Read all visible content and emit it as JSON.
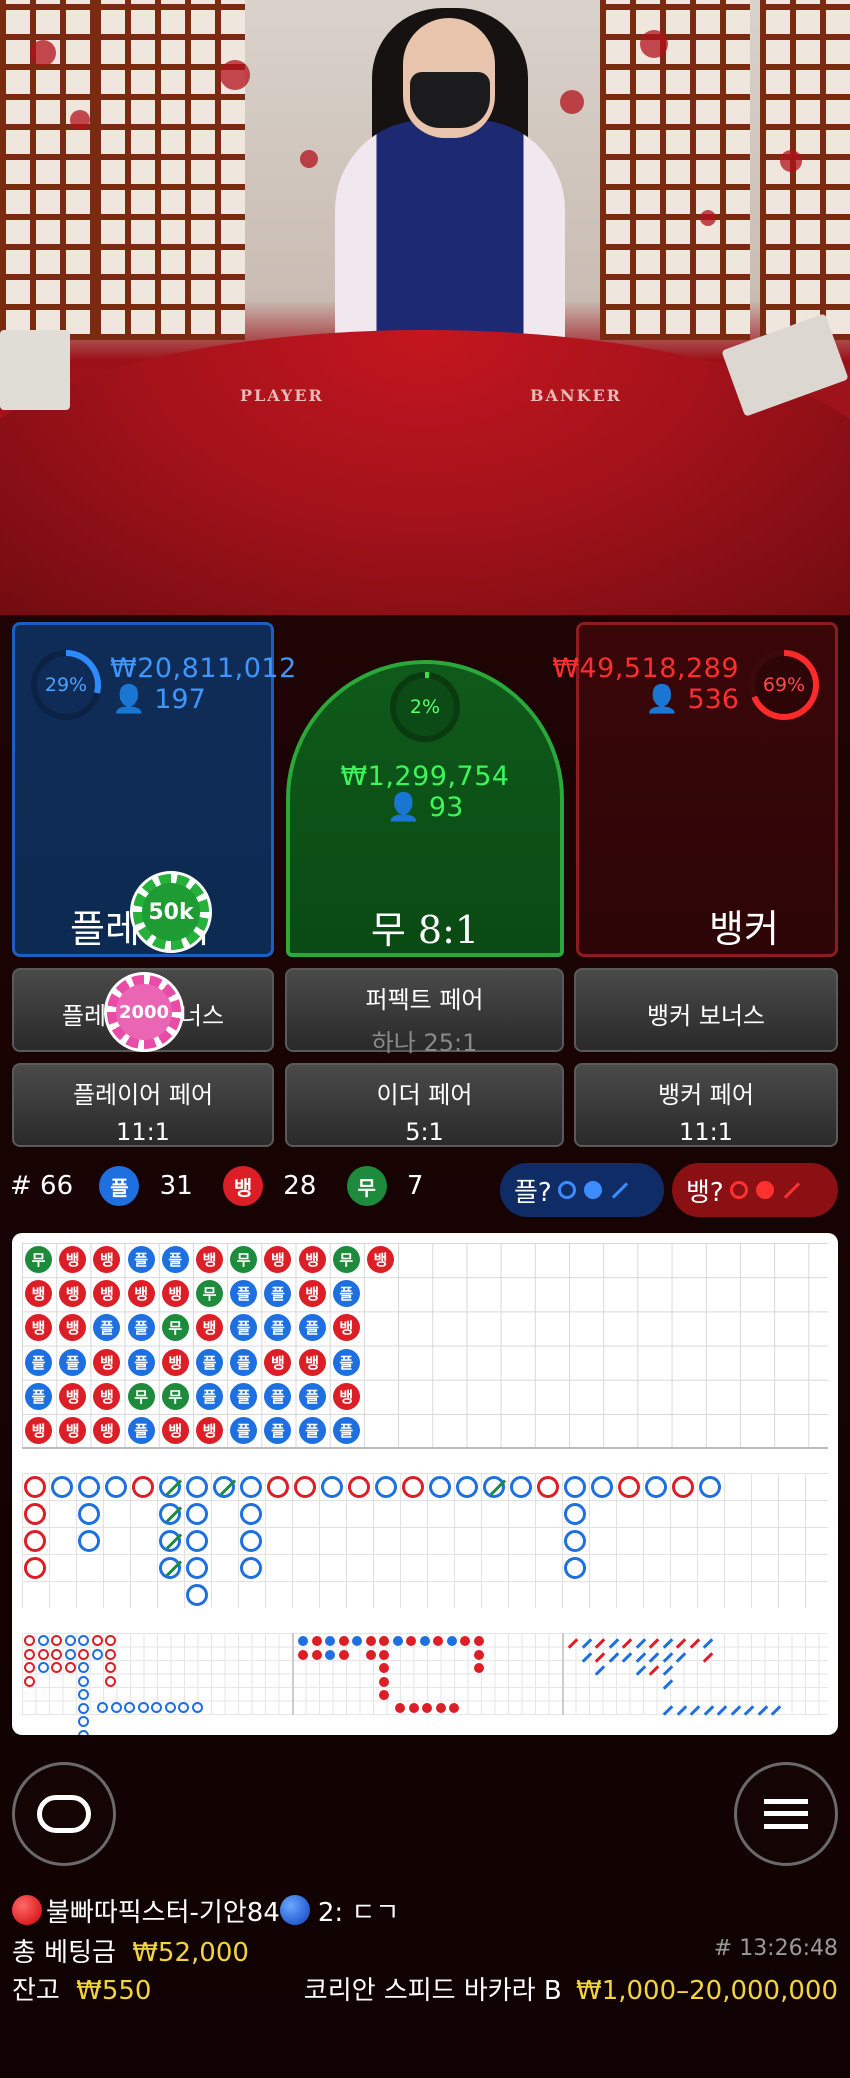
{
  "video": {
    "felt_left": "PLAYER",
    "felt_right": "BANKER"
  },
  "player": {
    "percent": "29%",
    "amount": "₩20,811,012",
    "count": "197",
    "label": "플레이어",
    "chip": "50k"
  },
  "tie": {
    "percent": "2%",
    "amount": "₩1,299,754",
    "count": "93",
    "label": "무 8:1"
  },
  "banker": {
    "percent": "69%",
    "amount": "₩49,518,289",
    "count": "536",
    "label": "뱅커"
  },
  "side_bets": [
    {
      "label": "플레이어 보너스",
      "odds": "",
      "chip": "2000"
    },
    {
      "label": "퍼펙트 페어",
      "odds": "하나 25:1"
    },
    {
      "label": "뱅커 보너스",
      "odds": ""
    },
    {
      "label": "플레이어 페어",
      "odds": "11:1"
    },
    {
      "label": "이더 페어",
      "odds": "5:1"
    },
    {
      "label": "뱅커 페어",
      "odds": "11:1"
    }
  ],
  "stats": {
    "round": "# 66",
    "player_badge": "플",
    "player_count": "31",
    "banker_badge": "뱅",
    "banker_count": "28",
    "tie_badge": "무",
    "tie_count": "7",
    "player_predict": "플?",
    "banker_predict": "뱅?"
  },
  "bead_road": [
    [
      "무",
      "뱅",
      "뱅",
      "플",
      "플",
      "뱅",
      "무",
      "뱅",
      "뱅",
      "무",
      "뱅"
    ],
    [
      "뱅",
      "뱅",
      "뱅",
      "뱅",
      "뱅",
      "무",
      "플",
      "플",
      "뱅",
      "플"
    ],
    [
      "뱅",
      "뱅",
      "플",
      "플",
      "무",
      "뱅",
      "플",
      "플",
      "플",
      "뱅"
    ],
    [
      "플",
      "플",
      "뱅",
      "플",
      "뱅",
      "플",
      "플",
      "뱅",
      "뱅",
      "플"
    ],
    [
      "플",
      "뱅",
      "뱅",
      "무",
      "무",
      "플",
      "플",
      "플",
      "플",
      "뱅"
    ],
    [
      "뱅",
      "뱅",
      "뱅",
      "플",
      "뱅",
      "뱅",
      "플",
      "플",
      "플",
      "플"
    ]
  ],
  "colors": {
    "player": "#1e6fe0",
    "banker": "#dc1e26",
    "tie": "#1e8a3c"
  },
  "bottom": {
    "user_line_a": "불빠따픽스터-기안84",
    "user_line_b": "2: ㄷㄱ",
    "total_bet_label": "총 베팅금",
    "total_bet": "₩52,000",
    "time": "# 13:26:48",
    "balance_label": "잔고",
    "balance": "₩550",
    "table_name": "코리안 스피드 바카라 B",
    "limits": "₩1,000–20,000,000"
  },
  "icons": {
    "chat": "chat-bubble-icon",
    "menu": "hamburger-menu-icon"
  }
}
